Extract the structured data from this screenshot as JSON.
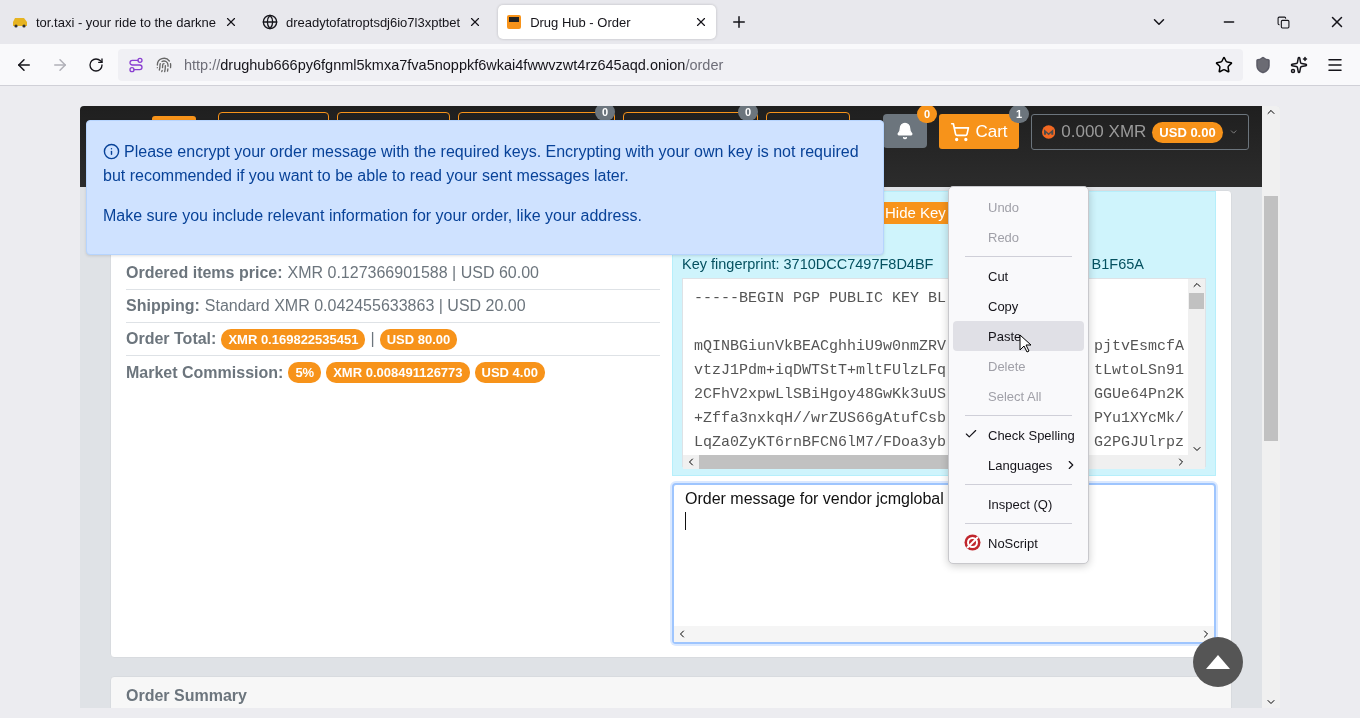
{
  "browser": {
    "tabs": [
      {
        "kind": "taxi",
        "title": "tor.taxi - your ride to the darkne",
        "selected": false
      },
      {
        "kind": "globe",
        "title": "dreadytofatroptsdj6io7l3xptbet",
        "selected": false
      },
      {
        "kind": "site",
        "title": "Drug Hub - Order",
        "selected": true
      }
    ],
    "forward_disabled": true,
    "address": {
      "scheme": "http://",
      "host": "drughub666py6fgnml5kmxa7fva5noppkf6wkai4fwwvzwt4rz645aqd.onion",
      "path": "/order"
    }
  },
  "header": {
    "nav_buttons": [
      {
        "kind": "plain"
      },
      {
        "kind": "plain"
      },
      {
        "kind": "badged",
        "badge": "0"
      },
      {
        "kind": "badged",
        "badge": "0"
      },
      {
        "kind": "plain"
      }
    ],
    "notifications_badge": "0",
    "cart": {
      "label": "Cart",
      "badge": "1"
    },
    "wallet": {
      "balance": "0.000 XMR",
      "usd": "USD 0.00"
    }
  },
  "alert": {
    "paragraphs": [
      "Please encrypt your order message with the required keys. Encrypting with your own key is not required but recommended if you want to be able to read your sent messages later.",
      "Make sure you include relevant information for your order, like your address."
    ]
  },
  "order_details": [
    {
      "label": "Ordered items price:",
      "parts": [
        {
          "kind": "text",
          "text": "XMR 0.127366901588 | USD 60.00"
        }
      ]
    },
    {
      "label": "Shipping:",
      "parts": [
        {
          "kind": "text",
          "text": "Standard XMR 0.042455633863 | USD 20.00"
        }
      ]
    },
    {
      "label": "Order Total:",
      "parts": [
        {
          "kind": "pill",
          "text": "XMR 0.169822535451"
        },
        {
          "kind": "text",
          "text": "|"
        },
        {
          "kind": "pill",
          "text": "USD 80.00"
        }
      ]
    },
    {
      "label": "Market Commission:",
      "parts": [
        {
          "kind": "pill",
          "text": "5%"
        },
        {
          "kind": "pill",
          "text": "XMR 0.008491126773"
        },
        {
          "kind": "pill",
          "text": "USD 4.00"
        }
      ]
    }
  ],
  "vendor_key": {
    "hide_button": "Hide Key",
    "fingerprint_left": "Key fingerprint: 3710DCC7497F8D4BF",
    "fingerprint_right": "B1F65A",
    "lines": [
      {
        "kind": "text",
        "left": "-----BEGIN PGP PUBLIC KEY BL"
      },
      {
        "kind": "blank"
      },
      {
        "kind": "text",
        "left": "mQINBGiunVkBEACghhiU9w0nmZRV",
        "right": "pjtvEsmcfA"
      },
      {
        "kind": "text",
        "left": "vtzJ1Pdm+iqDWTStT+mltFUlzLFq",
        "right": "tLwtoLSn91"
      },
      {
        "kind": "text",
        "left": "2CFhV2xpwLlSBiHgoy48GwKk3uUS",
        "right": "GGUe64Pn2K"
      },
      {
        "kind": "text",
        "left": "+Zffa3nxkqH//wrZUS66gAtufCsb",
        "right": "PYu1XYcMk/"
      },
      {
        "kind": "text",
        "left": "LqZa0ZyKT6rnBFCN6lM7/FDoa3yb",
        "right": "G2PGJUlrpz"
      }
    ]
  },
  "message": {
    "value": "Order message for vendor jcmglobal"
  },
  "context_menu": {
    "items": [
      {
        "kind": "item",
        "label": "Undo",
        "disabled": true,
        "highlighted": false
      },
      {
        "kind": "item",
        "label": "Redo",
        "disabled": true,
        "highlighted": false
      },
      {
        "kind": "separator"
      },
      {
        "kind": "item",
        "label": "Cut",
        "disabled": false,
        "highlighted": false
      },
      {
        "kind": "item",
        "label": "Copy",
        "disabled": false,
        "highlighted": false
      },
      {
        "kind": "item",
        "label": "Paste",
        "disabled": false,
        "highlighted": true
      },
      {
        "kind": "item",
        "label": "Delete",
        "disabled": true,
        "highlighted": false
      },
      {
        "kind": "item",
        "label": "Select All",
        "disabled": true,
        "highlighted": false
      },
      {
        "kind": "separator"
      },
      {
        "kind": "check",
        "label": "Check Spelling",
        "checked": true,
        "highlighted": false
      },
      {
        "kind": "submenu",
        "label": "Languages",
        "highlighted": false
      },
      {
        "kind": "separator"
      },
      {
        "kind": "item",
        "label": "Inspect (Q)",
        "disabled": false,
        "highlighted": false
      },
      {
        "kind": "separator"
      },
      {
        "kind": "extension",
        "label": "NoScript",
        "highlighted": false
      }
    ]
  },
  "order_summary": {
    "title": "Order Summary"
  }
}
